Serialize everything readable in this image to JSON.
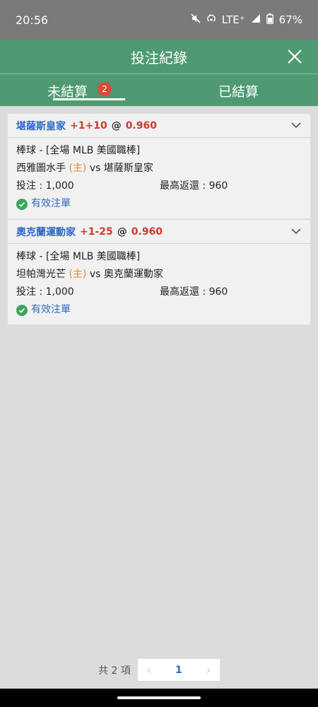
{
  "status": {
    "time": "20:56",
    "network": "LTE⁺",
    "battery": "67%"
  },
  "header": {
    "title": "投注紀錄"
  },
  "tabs": [
    {
      "label": "未結算",
      "badge": "2"
    },
    {
      "label": "已結算"
    }
  ],
  "bets": [
    {
      "team": "堪薩斯皇家",
      "line": "+1+10",
      "at": "@",
      "price": "0.960",
      "category": "棒球 - [全場 MLB 美國職棒]",
      "match_home": "西雅圖水手",
      "home_mark": "(主)",
      "vs": "vs",
      "match_away": "堪薩斯皇家",
      "stake": "投注 : 1,000",
      "max_return": "最高返還 : 960",
      "status": "有效注單"
    },
    {
      "team": "奧克蘭運動家",
      "line": "+1-25",
      "at": "@",
      "price": "0.960",
      "category": "棒球 - [全場 MLB 美國職棒]",
      "match_home": "坦帕灣光芒",
      "home_mark": "(主)",
      "vs": "vs",
      "match_away": "奧克蘭運動家",
      "stake": "投注 : 1,000",
      "max_return": "最高返還 : 960",
      "status": "有效注單"
    }
  ],
  "pagination": {
    "total": "共 2 項",
    "current_page": "1",
    "prev": "‹",
    "next": "›"
  }
}
